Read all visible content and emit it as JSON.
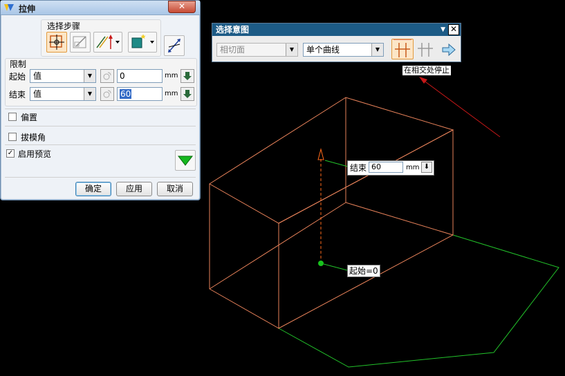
{
  "dialog": {
    "title": "拉伸",
    "close_label": "✕",
    "selection_steps_label": "选择步骤",
    "limits_label": "限制",
    "start": {
      "label": "起始",
      "mode": "值",
      "value": "0",
      "unit": "mm"
    },
    "end": {
      "label": "结束",
      "mode": "值",
      "value": "60",
      "unit": "mm"
    },
    "offset_label": "偏置",
    "offset_checked": false,
    "draft_label": "拔模角",
    "draft_checked": false,
    "preview_label": "启用预览",
    "preview_checked": true,
    "ok_label": "确定",
    "apply_label": "应用",
    "cancel_label": "取消"
  },
  "intent_toolbar": {
    "title": "选择意图",
    "face_rule": "相切面",
    "curve_rule": "单个曲线",
    "close_label": "✕"
  },
  "tooltip": "在相交处停止",
  "canvas": {
    "end_label": "结束",
    "end_value": "60",
    "end_unit": "mm",
    "start_label": "起始=0"
  },
  "colors": {
    "preview_body": "#e8825a",
    "section_curve": "#22c22a",
    "direction_vector": "#ff6a1a",
    "arrow_annotation": "#c81818"
  }
}
